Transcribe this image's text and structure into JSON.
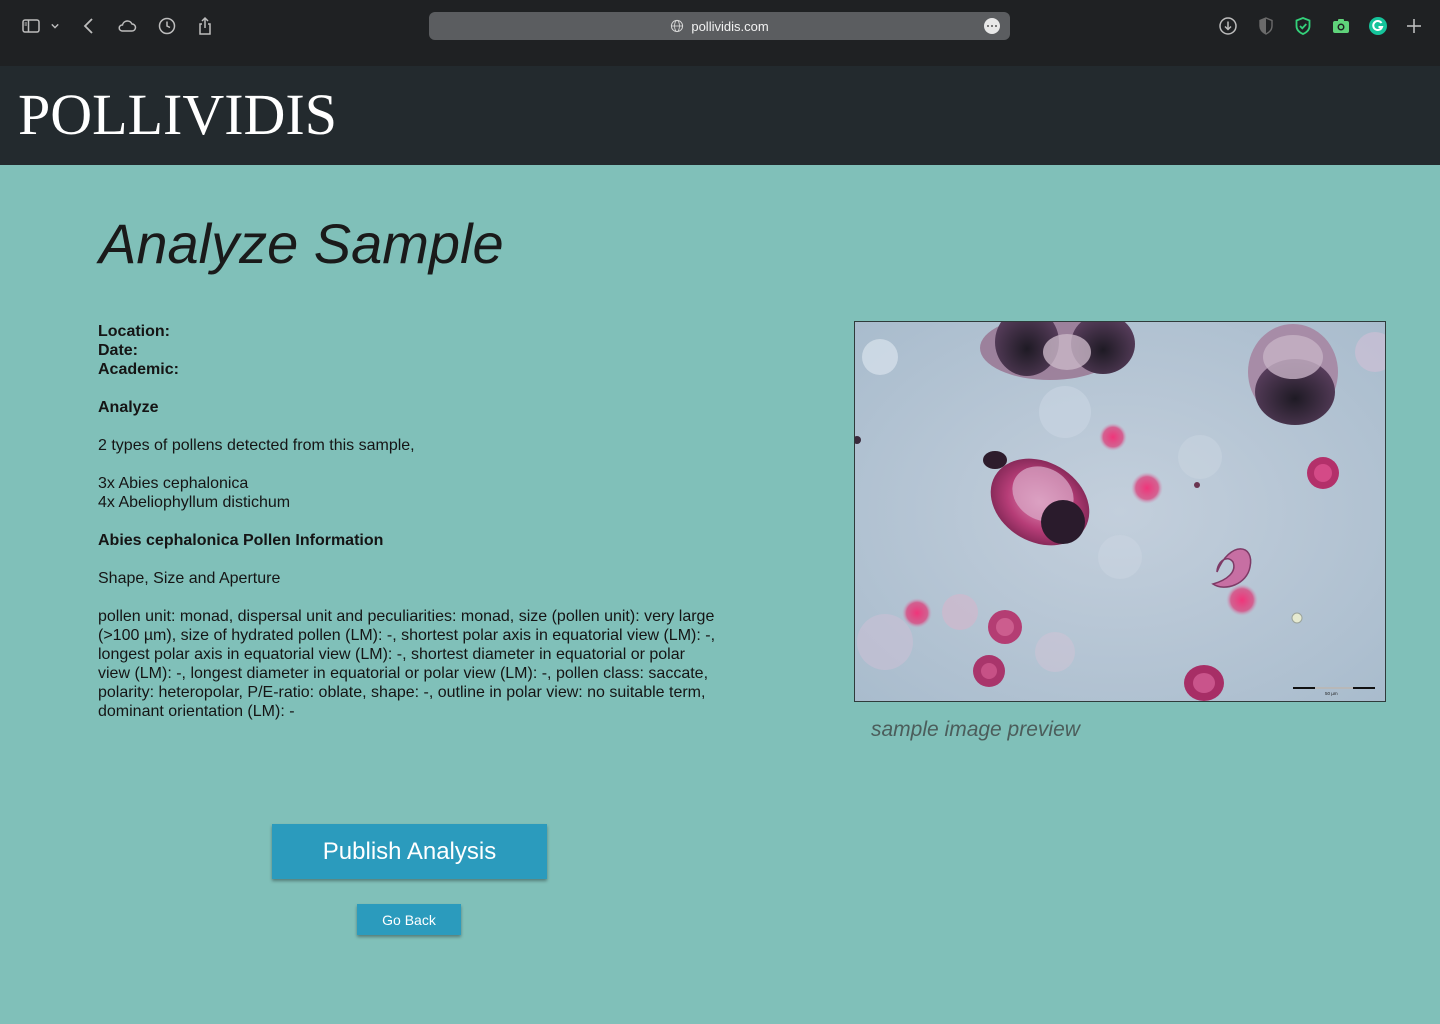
{
  "browser": {
    "url": "pollividis.com",
    "colors": {
      "chrome_bg": "#1f2123",
      "url_bg": "#5b5d60"
    },
    "toolbar_left_icons": [
      "sidebar-icon",
      "chevron-down-icon",
      "back-icon",
      "cloud-icon",
      "history-icon",
      "share-icon"
    ],
    "toolbar_right_icons": [
      "download-icon",
      "shield-half-icon",
      "shield-check-icon",
      "camera-icon",
      "grammarly-icon",
      "new-tab-icon"
    ]
  },
  "header": {
    "logo": "POLLIVIDIS",
    "background": "#232a2e"
  },
  "main": {
    "title": "Analyze Sample",
    "location_label": "Location:",
    "date_label": "Date:",
    "academic_label": "Academic:",
    "analyze_heading": "Analyze",
    "summary": "2 types of pollens detected from this sample,",
    "detections": [
      "3x Abies cephalonica",
      "4x Abeliophyllum distichum"
    ],
    "info_heading": "Abies cephalonica Pollen Information",
    "subheading": "Shape, Size and Aperture",
    "description": "pollen unit: monad,  dispersal unit and peculiarities: monad,  size (pollen unit): very large (>100 µm),  size of hydrated pollen (LM): -,  shortest polar axis in equatorial view (LM): -,  longest polar axis in equatorial view (LM): -,  shortest diameter in equatorial or polar view (LM): -,  longest diameter in equatorial or polar view (LM): -,  pollen class: saccate,  polarity: heteropolar,  P/E-ratio: oblate,  shape: -,  outline in polar view: no suitable term,  dominant orientation (LM): -",
    "image_caption": "sample image preview",
    "scale_bar_label": "50 µm"
  },
  "actions": {
    "publish_label": "Publish Analysis",
    "back_label": "Go Back",
    "button_color": "#2b9bbd"
  },
  "page_background": "#80c0b9"
}
